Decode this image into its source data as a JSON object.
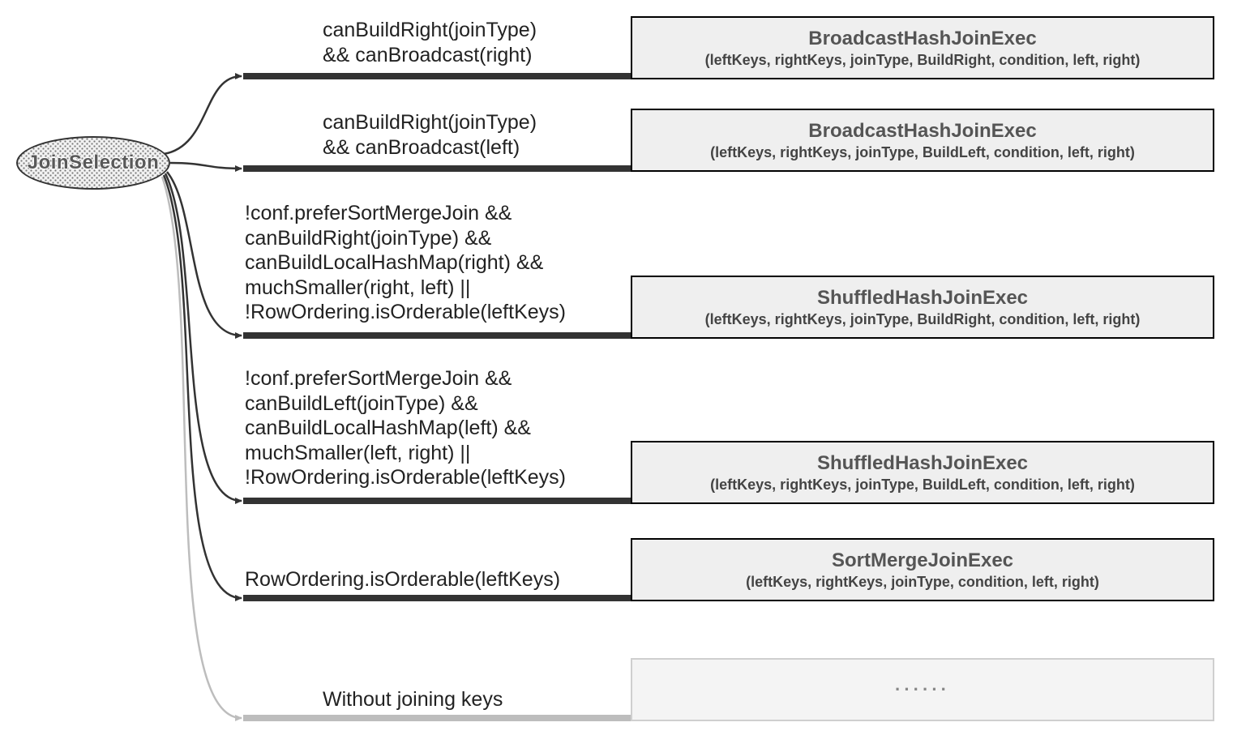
{
  "root": {
    "label": "JoinSelection"
  },
  "branches": [
    {
      "condition": "canBuildRight(joinType)\n&& canBroadcast(right)",
      "dest_title": "BroadcastHashJoinExec",
      "dest_params": "(leftKeys, rightKeys, joinType, BuildRight, condition, left, right)"
    },
    {
      "condition": "canBuildRight(joinType)\n&& canBroadcast(left)",
      "dest_title": "BroadcastHashJoinExec",
      "dest_params": "(leftKeys, rightKeys, joinType, BuildLeft, condition, left, right)"
    },
    {
      "condition": "!conf.preferSortMergeJoin &&\ncanBuildRight(joinType) &&\ncanBuildLocalHashMap(right) &&\nmuchSmaller(right, left) ||\n!RowOrdering.isOrderable(leftKeys)",
      "dest_title": "ShuffledHashJoinExec",
      "dest_params": "(leftKeys, rightKeys, joinType, BuildRight, condition, left, right)"
    },
    {
      "condition": "!conf.preferSortMergeJoin &&\ncanBuildLeft(joinType) &&\ncanBuildLocalHashMap(left) &&\nmuchSmaller(left, right) ||\n!RowOrdering.isOrderable(leftKeys)",
      "dest_title": "ShuffledHashJoinExec",
      "dest_params": "(leftKeys, rightKeys, joinType, BuildLeft, condition, left, right)"
    },
    {
      "condition": "RowOrdering.isOrderable(leftKeys)",
      "dest_title": "SortMergeJoinExec",
      "dest_params": "(leftKeys, rightKeys, joinType, condition, left, right)"
    },
    {
      "condition": "Without joining keys",
      "dest_title": "",
      "dest_params": "",
      "dest_ellipsis": "······",
      "dimmed": true
    }
  ]
}
